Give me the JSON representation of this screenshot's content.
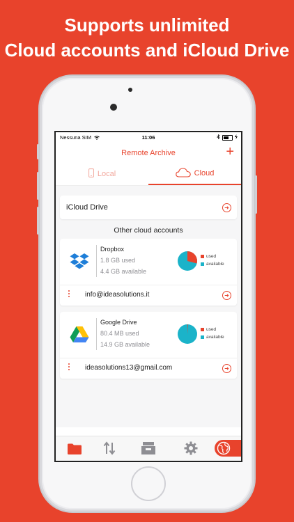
{
  "promo": {
    "line1": "Supports unlimited",
    "line2": "Cloud accounts and iCloud Drive"
  },
  "status": {
    "carrier": "Nessuna SIM",
    "time": "11:06"
  },
  "nav": {
    "title": "Remote Archive",
    "add": "+"
  },
  "segments": {
    "local": "Local",
    "cloud": "Cloud"
  },
  "icloud": {
    "label": "iCloud Drive"
  },
  "other_title": "Other cloud accounts",
  "accounts": [
    {
      "name": "Dropbox",
      "used": "1.8 GB used",
      "available": "4.4 GB available",
      "email": "info@ideasolutions.it",
      "used_fraction": 0.29
    },
    {
      "name": "Google Drive",
      "used": "80.4 MB used",
      "available": "14.9 GB available",
      "email": "ideasolutions13@gmail.com",
      "used_fraction": 0.01
    }
  ],
  "legend": {
    "used": "used",
    "available": "available"
  },
  "colors": {
    "accent": "#E8432C",
    "used": "#E8432C",
    "available": "#1BB3C9"
  },
  "tabs": [
    "folder-icon",
    "transfer-icon",
    "archive-icon",
    "gear-icon",
    "globe-icon"
  ]
}
